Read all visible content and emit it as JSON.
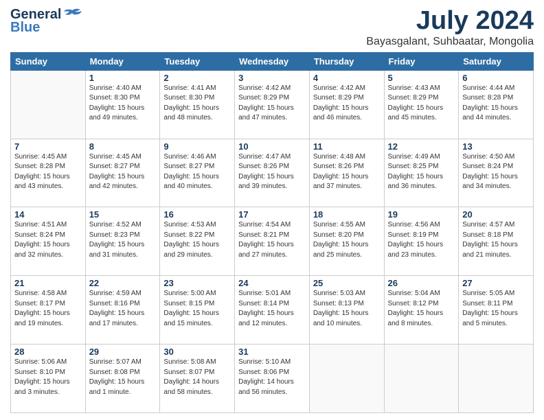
{
  "header": {
    "logo_line1": "General",
    "logo_line2": "Blue",
    "month": "July 2024",
    "location": "Bayasgalant, Suhbaatar, Mongolia"
  },
  "weekdays": [
    "Sunday",
    "Monday",
    "Tuesday",
    "Wednesday",
    "Thursday",
    "Friday",
    "Saturday"
  ],
  "weeks": [
    [
      {
        "day": "",
        "info": ""
      },
      {
        "day": "1",
        "info": "Sunrise: 4:40 AM\nSunset: 8:30 PM\nDaylight: 15 hours\nand 49 minutes."
      },
      {
        "day": "2",
        "info": "Sunrise: 4:41 AM\nSunset: 8:30 PM\nDaylight: 15 hours\nand 48 minutes."
      },
      {
        "day": "3",
        "info": "Sunrise: 4:42 AM\nSunset: 8:29 PM\nDaylight: 15 hours\nand 47 minutes."
      },
      {
        "day": "4",
        "info": "Sunrise: 4:42 AM\nSunset: 8:29 PM\nDaylight: 15 hours\nand 46 minutes."
      },
      {
        "day": "5",
        "info": "Sunrise: 4:43 AM\nSunset: 8:29 PM\nDaylight: 15 hours\nand 45 minutes."
      },
      {
        "day": "6",
        "info": "Sunrise: 4:44 AM\nSunset: 8:28 PM\nDaylight: 15 hours\nand 44 minutes."
      }
    ],
    [
      {
        "day": "7",
        "info": "Sunrise: 4:45 AM\nSunset: 8:28 PM\nDaylight: 15 hours\nand 43 minutes."
      },
      {
        "day": "8",
        "info": "Sunrise: 4:45 AM\nSunset: 8:27 PM\nDaylight: 15 hours\nand 42 minutes."
      },
      {
        "day": "9",
        "info": "Sunrise: 4:46 AM\nSunset: 8:27 PM\nDaylight: 15 hours\nand 40 minutes."
      },
      {
        "day": "10",
        "info": "Sunrise: 4:47 AM\nSunset: 8:26 PM\nDaylight: 15 hours\nand 39 minutes."
      },
      {
        "day": "11",
        "info": "Sunrise: 4:48 AM\nSunset: 8:26 PM\nDaylight: 15 hours\nand 37 minutes."
      },
      {
        "day": "12",
        "info": "Sunrise: 4:49 AM\nSunset: 8:25 PM\nDaylight: 15 hours\nand 36 minutes."
      },
      {
        "day": "13",
        "info": "Sunrise: 4:50 AM\nSunset: 8:24 PM\nDaylight: 15 hours\nand 34 minutes."
      }
    ],
    [
      {
        "day": "14",
        "info": "Sunrise: 4:51 AM\nSunset: 8:24 PM\nDaylight: 15 hours\nand 32 minutes."
      },
      {
        "day": "15",
        "info": "Sunrise: 4:52 AM\nSunset: 8:23 PM\nDaylight: 15 hours\nand 31 minutes."
      },
      {
        "day": "16",
        "info": "Sunrise: 4:53 AM\nSunset: 8:22 PM\nDaylight: 15 hours\nand 29 minutes."
      },
      {
        "day": "17",
        "info": "Sunrise: 4:54 AM\nSunset: 8:21 PM\nDaylight: 15 hours\nand 27 minutes."
      },
      {
        "day": "18",
        "info": "Sunrise: 4:55 AM\nSunset: 8:20 PM\nDaylight: 15 hours\nand 25 minutes."
      },
      {
        "day": "19",
        "info": "Sunrise: 4:56 AM\nSunset: 8:19 PM\nDaylight: 15 hours\nand 23 minutes."
      },
      {
        "day": "20",
        "info": "Sunrise: 4:57 AM\nSunset: 8:18 PM\nDaylight: 15 hours\nand 21 minutes."
      }
    ],
    [
      {
        "day": "21",
        "info": "Sunrise: 4:58 AM\nSunset: 8:17 PM\nDaylight: 15 hours\nand 19 minutes."
      },
      {
        "day": "22",
        "info": "Sunrise: 4:59 AM\nSunset: 8:16 PM\nDaylight: 15 hours\nand 17 minutes."
      },
      {
        "day": "23",
        "info": "Sunrise: 5:00 AM\nSunset: 8:15 PM\nDaylight: 15 hours\nand 15 minutes."
      },
      {
        "day": "24",
        "info": "Sunrise: 5:01 AM\nSunset: 8:14 PM\nDaylight: 15 hours\nand 12 minutes."
      },
      {
        "day": "25",
        "info": "Sunrise: 5:03 AM\nSunset: 8:13 PM\nDaylight: 15 hours\nand 10 minutes."
      },
      {
        "day": "26",
        "info": "Sunrise: 5:04 AM\nSunset: 8:12 PM\nDaylight: 15 hours\nand 8 minutes."
      },
      {
        "day": "27",
        "info": "Sunrise: 5:05 AM\nSunset: 8:11 PM\nDaylight: 15 hours\nand 5 minutes."
      }
    ],
    [
      {
        "day": "28",
        "info": "Sunrise: 5:06 AM\nSunset: 8:10 PM\nDaylight: 15 hours\nand 3 minutes."
      },
      {
        "day": "29",
        "info": "Sunrise: 5:07 AM\nSunset: 8:08 PM\nDaylight: 15 hours\nand 1 minute."
      },
      {
        "day": "30",
        "info": "Sunrise: 5:08 AM\nSunset: 8:07 PM\nDaylight: 14 hours\nand 58 minutes."
      },
      {
        "day": "31",
        "info": "Sunrise: 5:10 AM\nSunset: 8:06 PM\nDaylight: 14 hours\nand 56 minutes."
      },
      {
        "day": "",
        "info": ""
      },
      {
        "day": "",
        "info": ""
      },
      {
        "day": "",
        "info": ""
      }
    ]
  ]
}
